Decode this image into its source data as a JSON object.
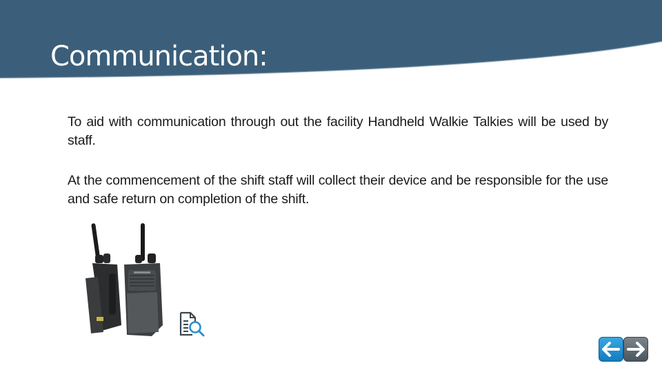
{
  "slide": {
    "title": "Communication:",
    "paragraphs": [
      "To aid with communication through out the facility Handheld Walkie Talkies will be used by staff.",
      "At the commencement of the shift staff will collect their device and be responsible for the use and safe return on completion of the shift."
    ],
    "image": {
      "subject": "two handheld walkie-talkie radios"
    },
    "icons": {
      "document_search": "document-search-icon",
      "prev": "arrow-left-icon",
      "next": "arrow-right-icon"
    },
    "colors": {
      "header": "#3b5f7a",
      "prev_button": "#1f8fd3",
      "next_button": "#5f6a72",
      "icon_blue": "#2a8fd0",
      "icon_dark": "#3a4550"
    }
  }
}
